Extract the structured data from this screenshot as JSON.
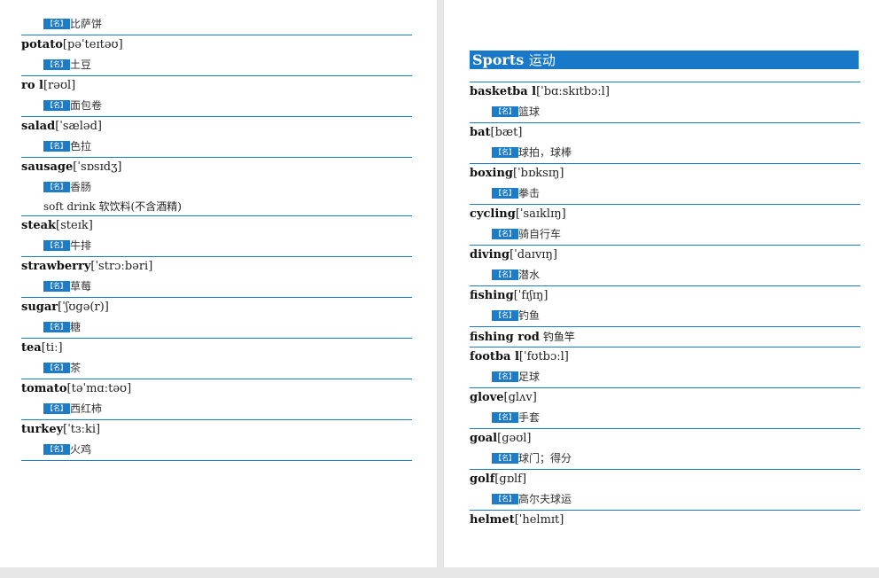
{
  "left_page": {
    "top_partial": {
      "pos": "【名】",
      "meaning": "比萨饼"
    },
    "entries": [
      {
        "word": "potato",
        "ipa": "[pəˈteɪtəʊ]",
        "pos": "【名】",
        "meaning": "土豆"
      },
      {
        "word": "ro l",
        "ipa": "[rəʊl]",
        "pos": "【名】",
        "meaning": "面包卷"
      },
      {
        "word": "salad",
        "ipa": "[ˈsæləd]",
        "pos": "【名】",
        "meaning": "色拉"
      },
      {
        "word": "sausage",
        "ipa": "[ˈsɒsɪdʒ]",
        "pos": "【名】",
        "meaning": "香肠",
        "extra": "soft drink 软饮料(不含酒精)"
      },
      {
        "word": "steak",
        "ipa": "[steɪk]",
        "pos": "【名】",
        "meaning": "牛排"
      },
      {
        "word": "strawberry",
        "ipa": "[ˈstrɔːbəri]",
        "pos": "【名】",
        "meaning": "草莓"
      },
      {
        "word": "sugar",
        "ipa": "[ˈʃʊgə(r)]",
        "pos": "【名】",
        "meaning": "糖"
      },
      {
        "word": "tea",
        "ipa": "[tiː]",
        "pos": "【名】",
        "meaning": "茶"
      },
      {
        "word": "tomato",
        "ipa": "[təˈmɑːtəʊ]",
        "pos": "【名】",
        "meaning": "西红柿"
      },
      {
        "word": "turkey",
        "ipa": "[ˈtɜːki]",
        "pos": "【名】",
        "meaning": "火鸡"
      }
    ]
  },
  "right_page": {
    "section": {
      "title_en": "Sports",
      "title_cn": "运动"
    },
    "entries": [
      {
        "word": "basketba l",
        "ipa": "[ˈbɑːskɪtbɔːl]",
        "pos": "【名】",
        "meaning": "篮球"
      },
      {
        "word": "bat",
        "ipa": "[bæt]",
        "pos": "【名】",
        "meaning": "球拍，球棒"
      },
      {
        "word": "boxing",
        "ipa": "[ˈbɒksɪŋ]",
        "pos": "【名】",
        "meaning": "拳击"
      },
      {
        "word": "cycling",
        "ipa": "[ˈsaɪklɪŋ]",
        "pos": "【名】",
        "meaning": "骑自行车"
      },
      {
        "word": "diving",
        "ipa": "[ˈdaɪvɪŋ]",
        "pos": "【名】",
        "meaning": "潜水"
      },
      {
        "word": "fishing",
        "ipa": "[ˈfɪʃɪŋ]",
        "pos": "【名】",
        "meaning": "钓鱼"
      },
      {
        "word": "fishing rod",
        "inline_meaning": "钓鱼竿"
      },
      {
        "word": "footba l",
        "ipa": "[ˈfʊtbɔːl]",
        "pos": "【名】",
        "meaning": "足球"
      },
      {
        "word": "glove",
        "ipa": "[glʌv]",
        "pos": "【名】",
        "meaning": "手套"
      },
      {
        "word": "goal",
        "ipa": "[gəʊl]",
        "pos": "【名】",
        "meaning": "球门；得分"
      },
      {
        "word": "golf",
        "ipa": "[gɒlf]",
        "pos": "【名】",
        "meaning": "高尔夫球运"
      },
      {
        "word": "helmet",
        "ipa": "[ˈhelmɪt]"
      }
    ]
  }
}
